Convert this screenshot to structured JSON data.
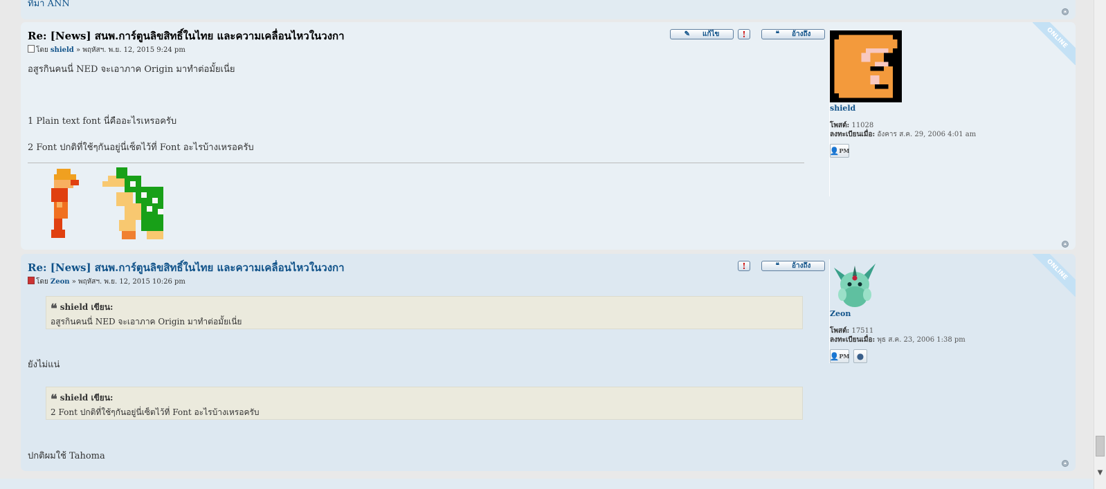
{
  "prev_post_tail": {
    "text": "ทีมา ANN"
  },
  "posts": [
    {
      "title": "Re: [News] สนพ.การ์ตูนลิขสิทธิ์ในไทย และความเคลื่อนไหวในวงกา",
      "author_prefix": "โดย",
      "author": "shield",
      "date": "» พฤหัสฯ. พ.ย. 12, 2015 9:24 pm",
      "buttons": {
        "edit": "แก้ไข",
        "report": "!",
        "quote": "อ้างถึง"
      },
      "lines": [
        "อสูรกินคนนี่ NED จะเอาภาค Origin มาทำต่อมั้ยเนี่ย",
        "1 Plain text font นี่คืออะไรเหรอครับ",
        "2 Font ปกติที่ใช้ๆกันอยู่นี่เซ็ตไว้ที่ Font อะไรบ้างเหรอครับ"
      ],
      "profile": {
        "name": "shield",
        "posts_label": "โพสต์:",
        "posts_value": "11028",
        "joined_label": "ลงทะเบียนเมื่อ:",
        "joined_value": "อังคาร ส.ค. 29, 2006 4:01 am",
        "online_badge": "ONLINE",
        "pm_label": "PM"
      }
    },
    {
      "title": "Re: [News] สนพ.การ์ตูนลิขสิทธิ์ในไทย และความเคลื่อนไหวในวงกา",
      "author_prefix": "โดย",
      "author": "Zeon",
      "date": "» พฤหัสฯ. พ.ย. 12, 2015 10:26 pm",
      "buttons": {
        "report": "!",
        "quote": "อ้างถึง"
      },
      "quotes": [
        {
          "cite": "shield เขียน:",
          "text": "อสูรกินคนนี่ NED จะเอาภาค Origin มาทำต่อมั้ยเนี่ย"
        },
        {
          "cite": "shield เขียน:",
          "text": "2 Font ปกติที่ใช้ๆกันอยู่นี่เซ็ตไว้ที่ Font อะไรบ้างเหรอครับ"
        }
      ],
      "replies": [
        "ยังไม่แน่",
        "ปกติผมใช้ Tahoma"
      ],
      "profile": {
        "name": "Zeon",
        "posts_label": "โพสต์:",
        "posts_value": "17511",
        "joined_label": "ลงทะเบียนเมื่อ:",
        "joined_value": "พุธ ส.ค. 23, 2006 1:38 pm",
        "online_badge": "ONLINE",
        "pm_label": "PM"
      }
    }
  ],
  "colors": {
    "link": "#105289",
    "post_bg_a": "#e9f0f5",
    "post_bg_b": "#dde8f1",
    "quote_bg": "#ebeadd"
  }
}
